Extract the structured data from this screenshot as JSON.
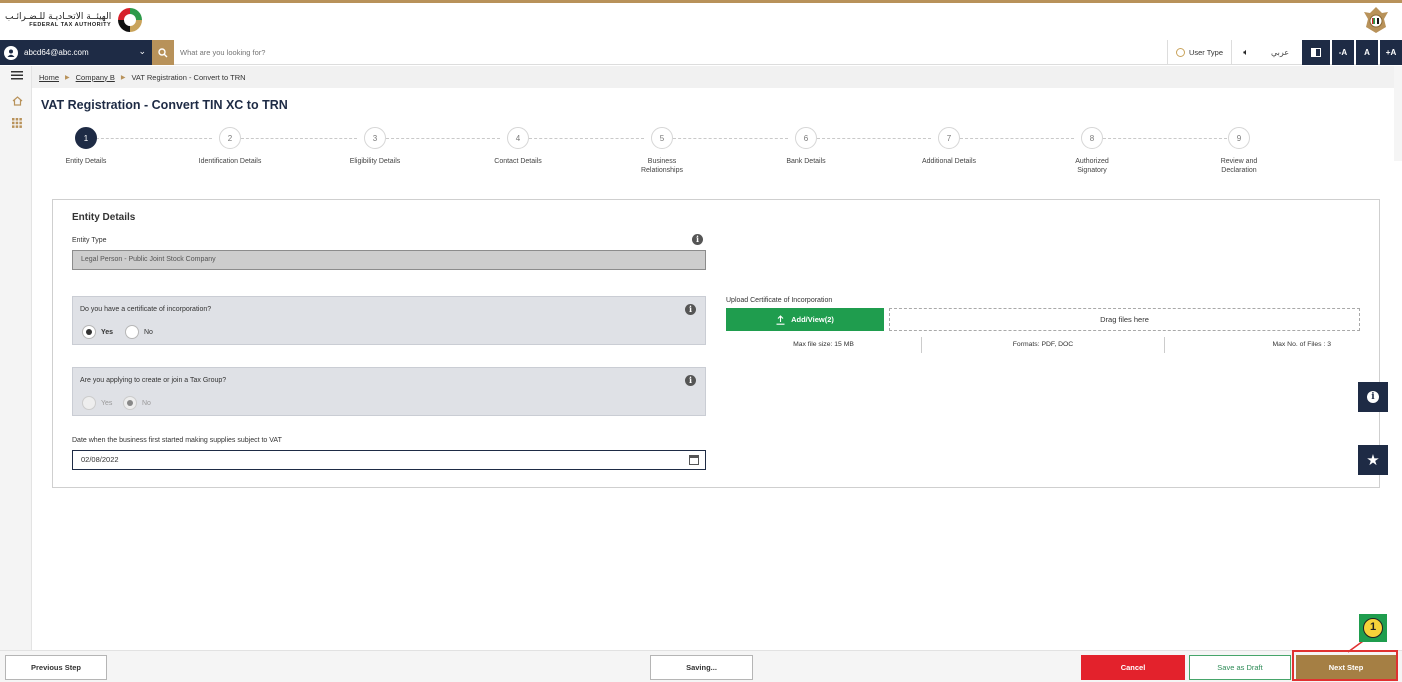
{
  "header": {
    "logo_ar": "الهيئــة الاتحـاديـة للـضـرائـب",
    "logo_en": "FEDERAL TAX AUTHORITY"
  },
  "topnav": {
    "user_email": "abcd64@abc.com",
    "search_placeholder": "What are you looking for?",
    "user_type_label": "User Type",
    "arabic_label": "عربي",
    "font_decrease": "-A",
    "font_reset": "A",
    "font_increase": "+A"
  },
  "breadcrumb": {
    "home": "Home",
    "company": "Company B",
    "current": "VAT Registration - Convert to TRN"
  },
  "page": {
    "title": "VAT Registration - Convert TIN XC to TRN"
  },
  "stepper": {
    "steps": [
      {
        "num": "1",
        "label": "Entity Details"
      },
      {
        "num": "2",
        "label": "Identification Details"
      },
      {
        "num": "3",
        "label": "Eligibility Details"
      },
      {
        "num": "4",
        "label": "Contact Details"
      },
      {
        "num": "5",
        "label": "Business Relationships"
      },
      {
        "num": "6",
        "label": "Bank Details"
      },
      {
        "num": "7",
        "label": "Additional Details"
      },
      {
        "num": "8",
        "label": "Authorized Signatory"
      },
      {
        "num": "9",
        "label": "Review and Declaration"
      }
    ]
  },
  "form": {
    "section_title": "Entity Details",
    "entity_type_label": "Entity Type",
    "entity_type_value": "Legal Person - Public Joint Stock Company",
    "q_certificate": "Do you have a certificate of incorporation?",
    "q_tax_group": "Are you applying to create or join a Tax Group?",
    "yes_label": "Yes",
    "no_label": "No",
    "date_label": "Date when the business first started making supplies subject to VAT",
    "date_value": "02/08/2022",
    "upload_label": "Upload Certificate of Incorporation",
    "add_view_label": "Add/View(2)",
    "drag_label": "Drag files here",
    "max_size": "Max file size: 15 MB",
    "formats": "Formats: PDF, DOC",
    "max_files": "Max No. of Files : 3"
  },
  "footer": {
    "previous": "Previous Step",
    "saving": "Saving...",
    "cancel": "Cancel",
    "save_draft": "Save as Draft",
    "next": "Next Step"
  },
  "annotation": {
    "callout_number": "1"
  },
  "colors": {
    "navy": "#1e2b45",
    "gold": "#b8925a",
    "green": "#1f9d4e",
    "red": "#e3222c"
  }
}
